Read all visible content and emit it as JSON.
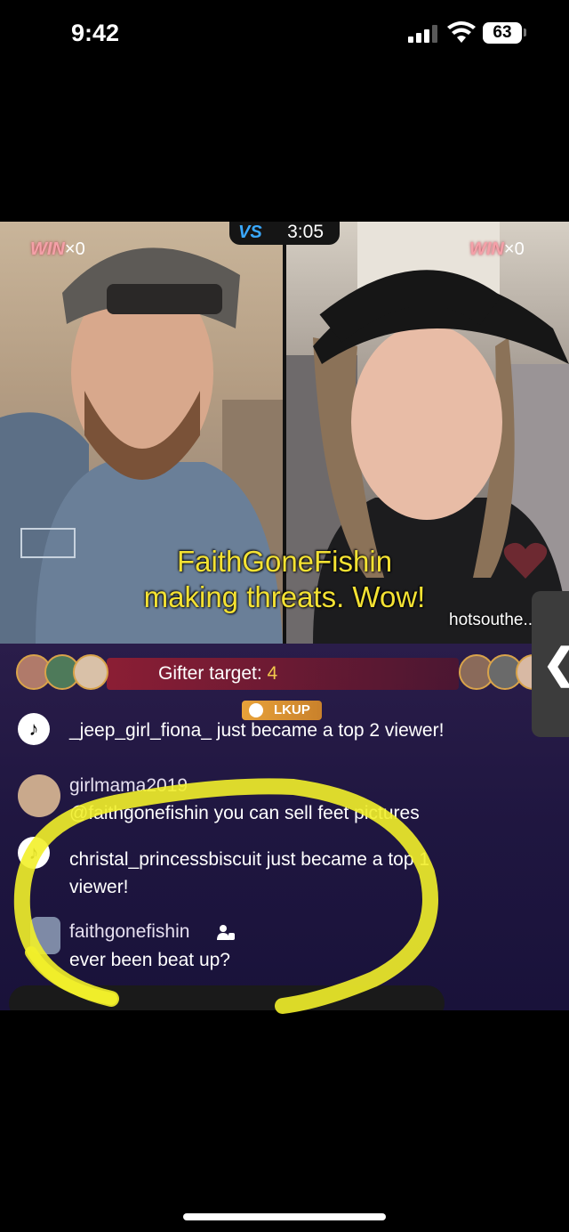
{
  "status_bar": {
    "time": "9:42",
    "battery": "63"
  },
  "battle": {
    "left_win": {
      "label": "WIN",
      "count": "×0"
    },
    "right_win": {
      "label": "WIN",
      "count": "×0"
    },
    "vs_label": "VS",
    "timer": "3:05"
  },
  "caption": {
    "line1": "FaithGoneFishin",
    "line2": "making threats. Wow!"
  },
  "host_name": "hotsouthe...",
  "gifter_target": {
    "label": "Gifter target: ",
    "value": "4"
  },
  "messages": [
    {
      "type": "system",
      "text": "_jeep_girl_fiona_ just became a top 2 viewer!"
    },
    {
      "type": "comment",
      "user": "girlmama2019",
      "text": "@faithgonefishin you can sell feet pictures"
    },
    {
      "type": "system",
      "text_line1": "christal_princessbiscuit just became a top 1",
      "text_line2": "viewer!"
    },
    {
      "type": "comment",
      "user": "faithgonefishin",
      "badge": "LKUP",
      "text": "ever been beat up?"
    }
  ],
  "colors": {
    "highlight": "#f2f02a",
    "gifter_value": "#f2c94c",
    "win_text": "#f4a0a8",
    "badge": "#e8a23a"
  },
  "icons": [
    "tiktok-icon",
    "heart-icon",
    "chevron-left-icon",
    "moderator-icon",
    "gem-icon"
  ]
}
